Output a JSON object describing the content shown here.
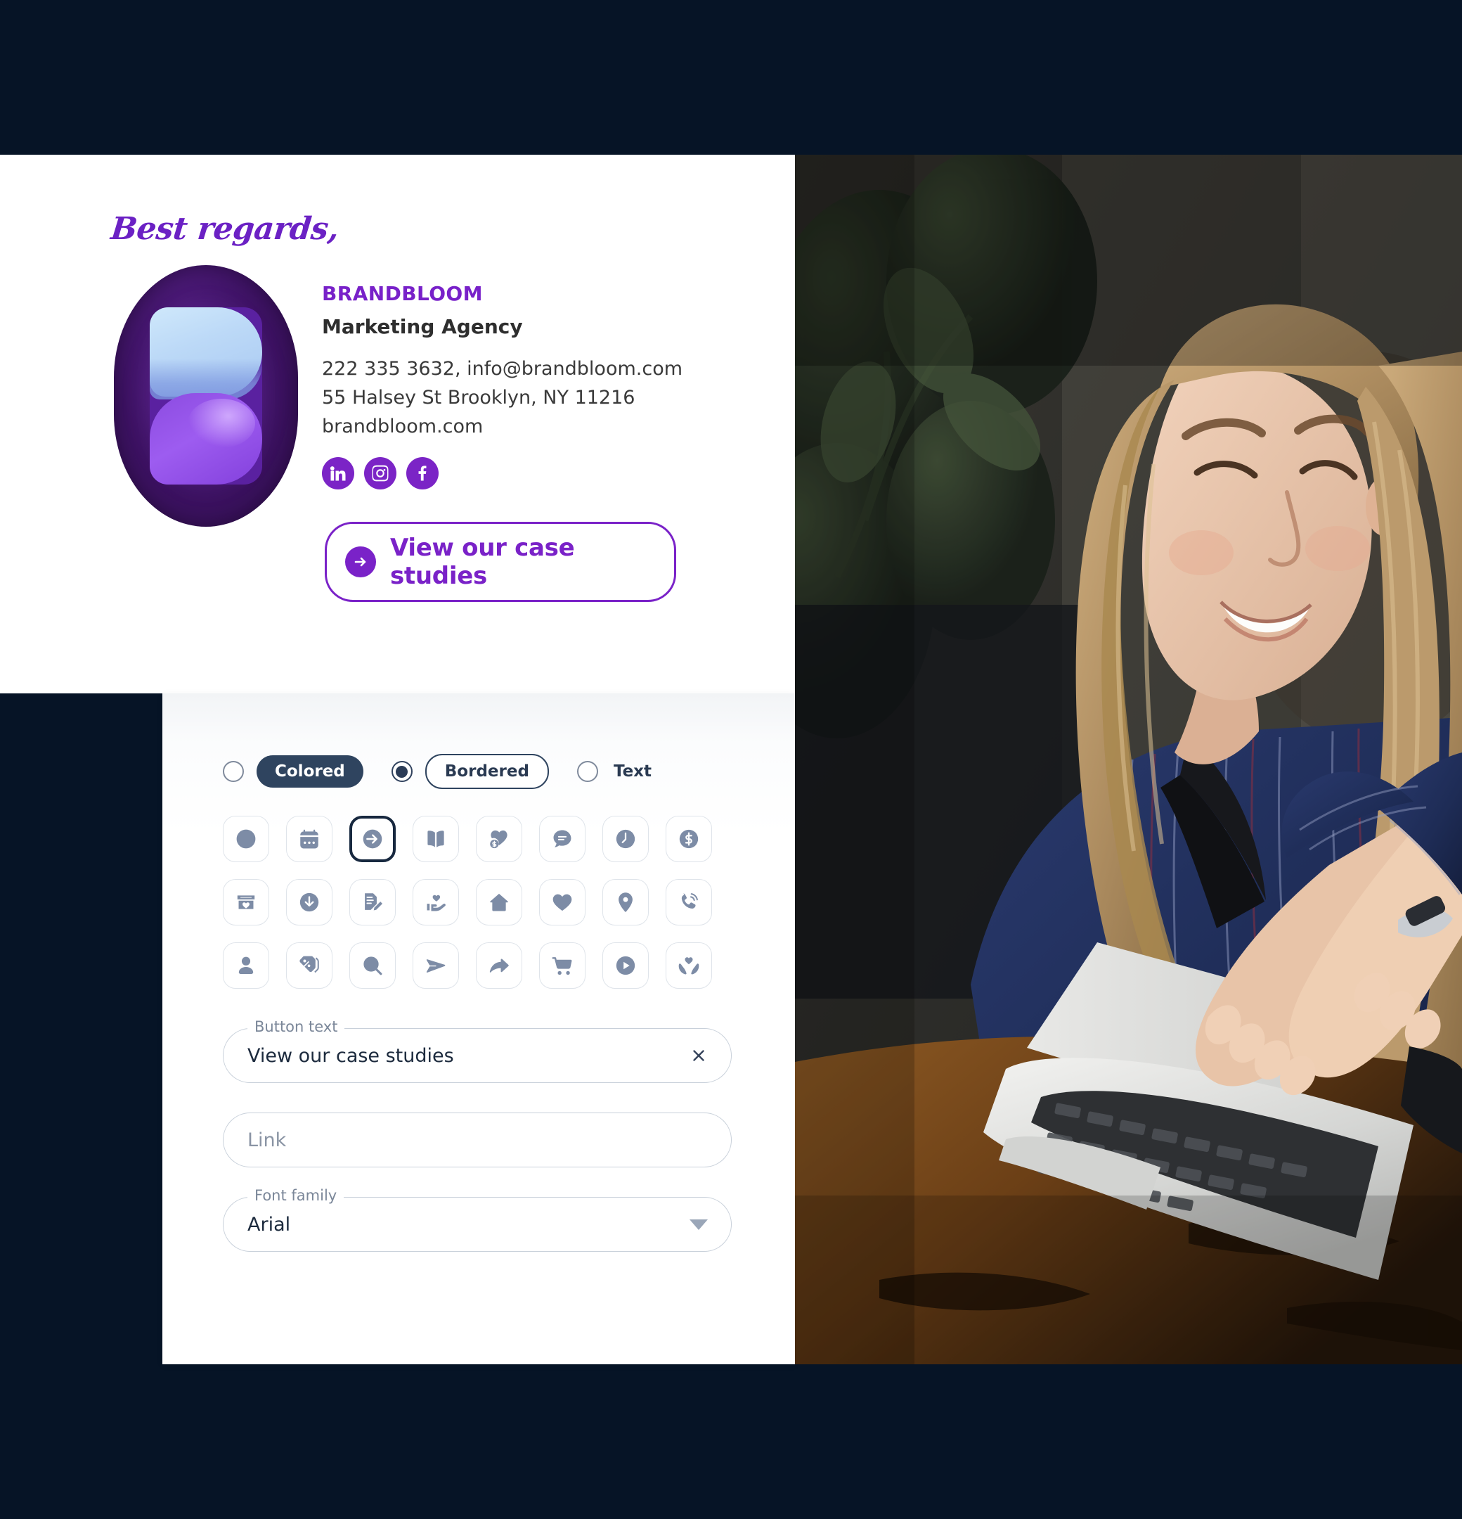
{
  "signature": {
    "salutation": "Best regards,",
    "logo_alt": "brandbloom-logo",
    "brand_name": "BRANDBLOOM",
    "role": "Marketing Agency",
    "contact_lines": [
      "222 335 3632, info@brandbloom.com",
      "55 Halsey St Brooklyn, NY 11216",
      "brandbloom.com"
    ],
    "social": [
      {
        "name": "linkedin",
        "label": "LinkedIn"
      },
      {
        "name": "instagram",
        "label": "Instagram"
      },
      {
        "name": "facebook",
        "label": "Facebook"
      }
    ],
    "cta": {
      "label": "View our case studies",
      "icon": "arrow-right-circle-icon"
    },
    "colors": {
      "brand_purple": "#7821c9",
      "cta_purple": "#7a22c8",
      "text_dark": "#2e2e2e"
    }
  },
  "editor": {
    "style_options": [
      {
        "label": "Colored",
        "style": "filled",
        "selected": false
      },
      {
        "label": "Bordered",
        "style": "outline",
        "selected": true
      },
      {
        "label": "Text",
        "style": "plain",
        "selected": false
      }
    ],
    "icon_picker": {
      "selected_index": 2,
      "icons": [
        {
          "name": "no-icon",
          "label": "None"
        },
        {
          "name": "calendar-icon",
          "label": "Calendar"
        },
        {
          "name": "arrow-right-circle-icon",
          "label": "Arrow right"
        },
        {
          "name": "book-open-icon",
          "label": "Book"
        },
        {
          "name": "heart-dollar-icon",
          "label": "Donate heart"
        },
        {
          "name": "chat-bubble-icon",
          "label": "Chat"
        },
        {
          "name": "clock-icon",
          "label": "Clock"
        },
        {
          "name": "dollar-circle-icon",
          "label": "Money"
        },
        {
          "name": "gift-box-icon",
          "label": "Gift"
        },
        {
          "name": "download-circle-icon",
          "label": "Download"
        },
        {
          "name": "edit-document-icon",
          "label": "Sign document"
        },
        {
          "name": "hand-heart-icon",
          "label": "Support"
        },
        {
          "name": "home-icon",
          "label": "Home"
        },
        {
          "name": "heart-icon",
          "label": "Heart"
        },
        {
          "name": "map-pin-icon",
          "label": "Location"
        },
        {
          "name": "phone-ring-icon",
          "label": "Call"
        },
        {
          "name": "user-icon",
          "label": "Profile"
        },
        {
          "name": "discount-tag-icon",
          "label": "Discount"
        },
        {
          "name": "search-icon",
          "label": "Search"
        },
        {
          "name": "send-icon",
          "label": "Send"
        },
        {
          "name": "share-arrow-icon",
          "label": "Share"
        },
        {
          "name": "shopping-cart-icon",
          "label": "Cart"
        },
        {
          "name": "play-circle-icon",
          "label": "Play"
        },
        {
          "name": "hands-heart-icon",
          "label": "Care"
        }
      ]
    },
    "fields": {
      "button_text": {
        "legend": "Button text",
        "value": "View our case studies",
        "action_icon": "close-icon"
      },
      "link": {
        "legend": "",
        "placeholder": "Link",
        "value": ""
      },
      "font_family": {
        "legend": "Font family",
        "value": "Arial",
        "action_icon": "chevron-down-icon"
      }
    }
  },
  "photo": {
    "alt": "woman-smiling-typing-on-laptop"
  },
  "page": {
    "background": "#061426"
  }
}
